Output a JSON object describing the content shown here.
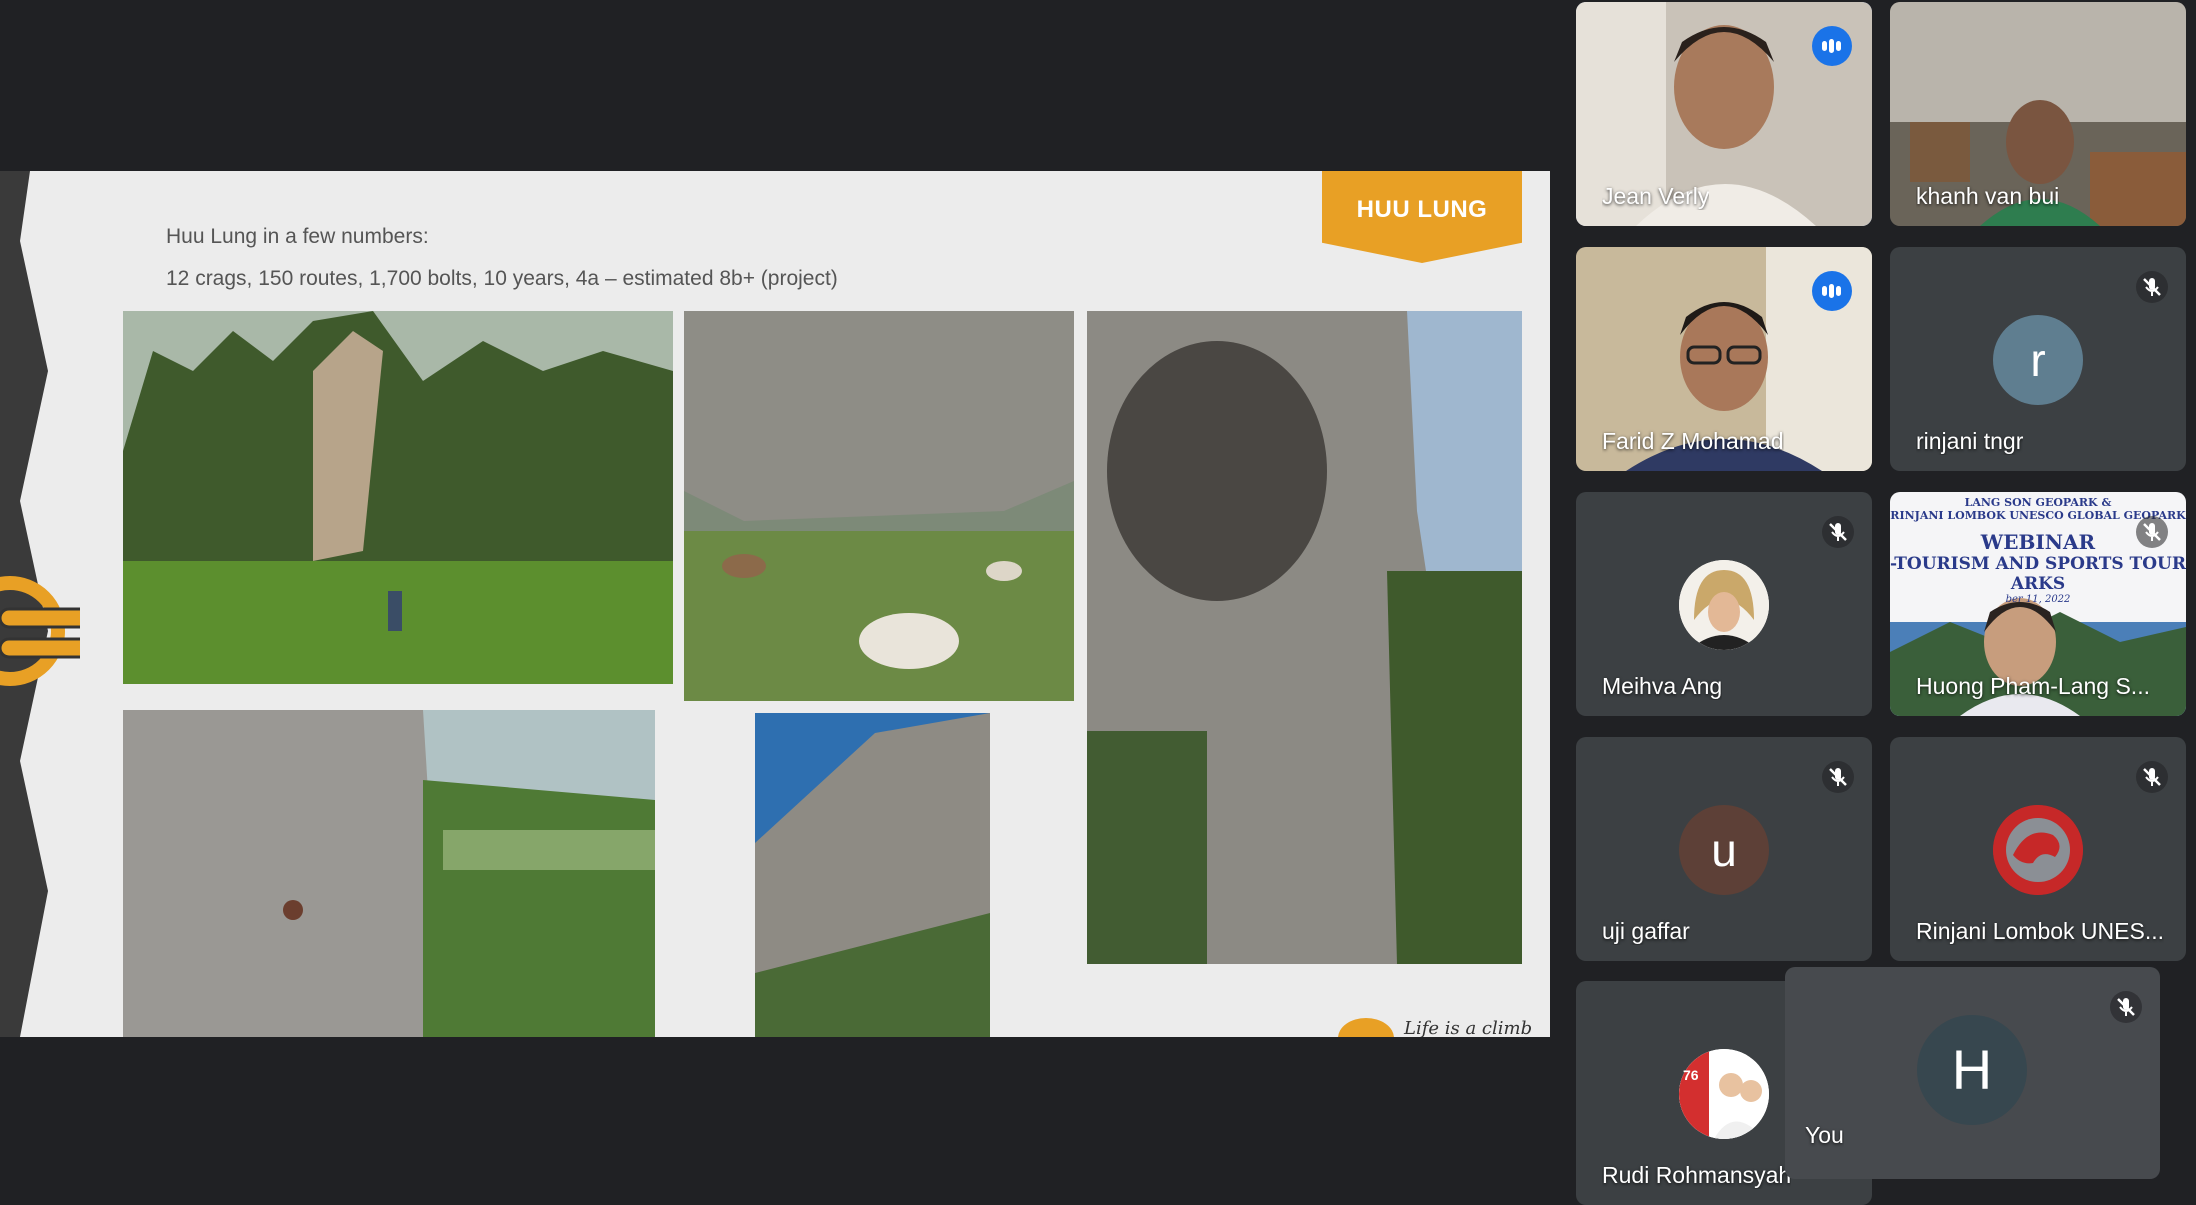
{
  "slide": {
    "tag": "HUU LUNG",
    "line1": "Huu Lung in a few numbers:",
    "line2": "12 crags, 150 routes, 1,700 bolts, 10 years, 4a – estimated 8b+ (project)",
    "motto": "Life is a climb",
    "accent_color": "#e8a025"
  },
  "participants": [
    {
      "name": "Jean Verly",
      "state": "speaking",
      "video": true
    },
    {
      "name": "khanh van bui",
      "state": "unmuted",
      "video": true
    },
    {
      "name": "Farid Z Mohamad",
      "state": "speaking",
      "video": true
    },
    {
      "name": "rinjani tngr",
      "state": "muted",
      "avatar_letter": "r",
      "avatar_color": "#5f7e90"
    },
    {
      "name": "Meihva Ang",
      "state": "muted",
      "avatar_type": "photo"
    },
    {
      "name": "Huong Pham-Lang S...",
      "state": "muted",
      "video": true,
      "banner": {
        "line1": "LANG SON GEOPARK &",
        "line2": "RINJANI LOMBOK UNESCO GLOBAL GEOPARK",
        "line3": "WEBINAR",
        "line4": "-TOURISM AND SPORTS TOURISM",
        "line5": "ARKS",
        "line6": "ber 11, 2022"
      }
    },
    {
      "name": "uji gaffar",
      "state": "muted",
      "avatar_letter": "u",
      "avatar_color": "#5d4037"
    },
    {
      "name": "Rinjani Lombok UNES...",
      "state": "muted",
      "avatar_type": "logo"
    },
    {
      "name": "Rudi Rohmansyah",
      "state": "muted",
      "avatar_type": "photo",
      "badge": "76"
    },
    {
      "name": "You",
      "state": "muted",
      "avatar_letter": "H",
      "avatar_color": "#37474f"
    }
  ]
}
